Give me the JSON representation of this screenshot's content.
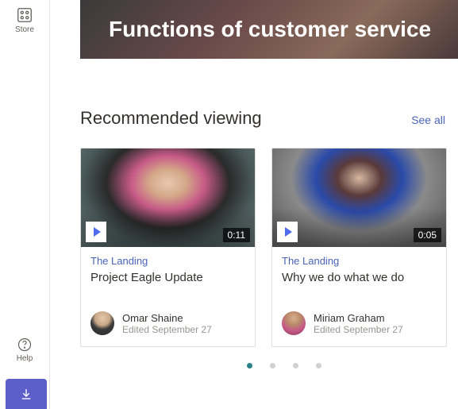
{
  "siderail": {
    "store_label": "Store",
    "help_label": "Help"
  },
  "hero": {
    "title": "Functions of customer service"
  },
  "section": {
    "title": "Recommended viewing",
    "see_all": "See all"
  },
  "cards": [
    {
      "duration": "0:11",
      "source": "The Landing",
      "title": "Project Eagle Update",
      "author": "Omar Shaine",
      "edited": "Edited September 27"
    },
    {
      "duration": "0:05",
      "source": "The Landing",
      "title": "Why we do what we do",
      "author": "Miriam Graham",
      "edited": "Edited September 27"
    }
  ],
  "carousel": {
    "dot_count": 4,
    "active_index": 0
  }
}
